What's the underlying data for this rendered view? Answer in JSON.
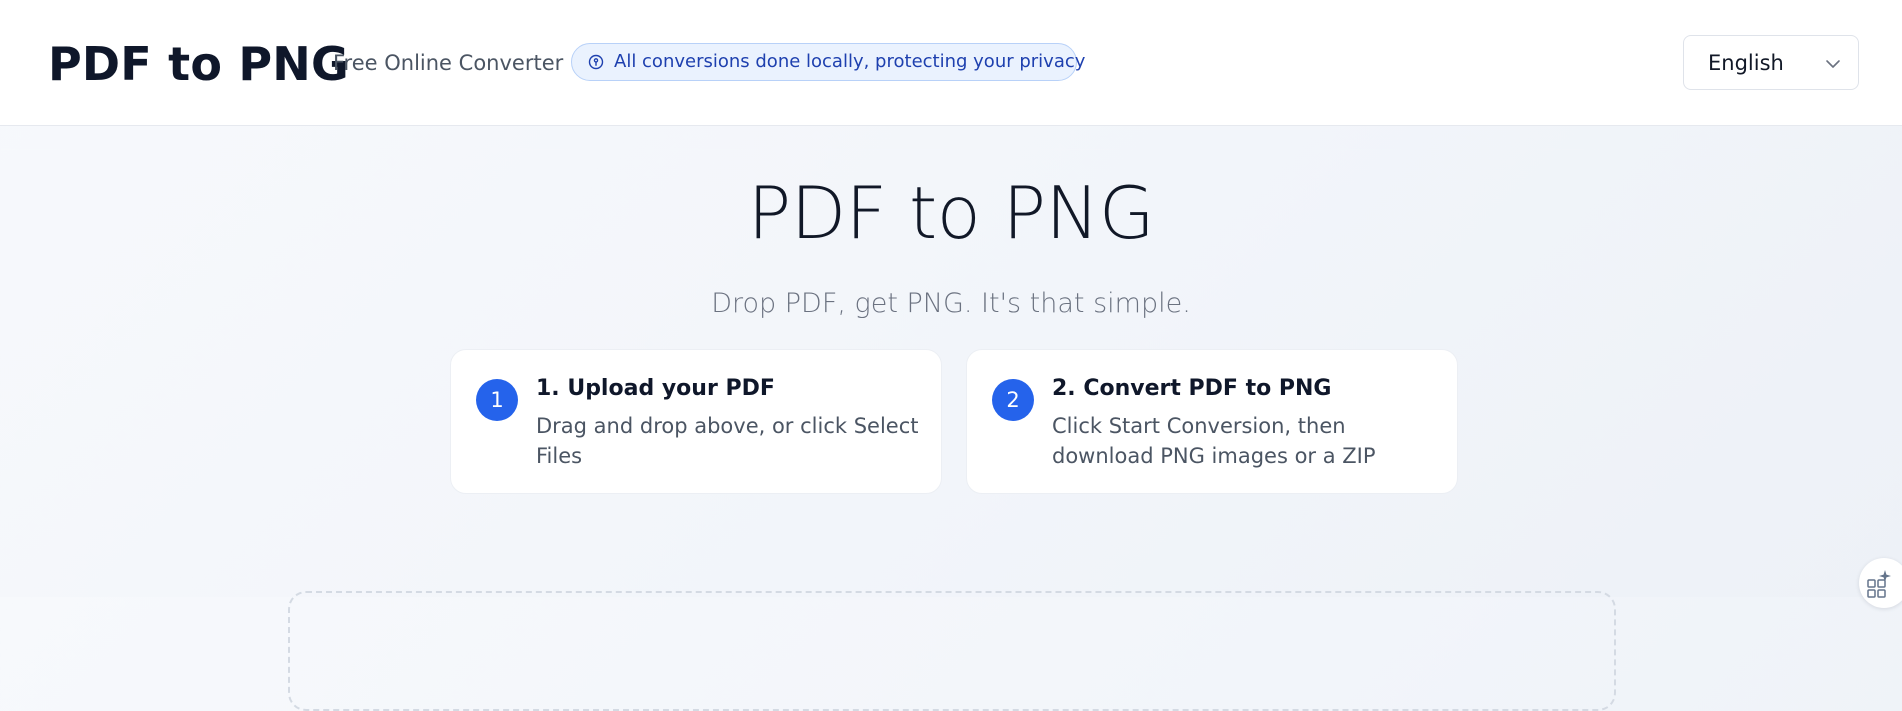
{
  "header": {
    "logo": "PDF to PNG",
    "tagline": "Free Online Converter",
    "privacy_notice": "All conversions done locally, protecting your privacy",
    "privacy_icon": "privacy-lock-icon",
    "language": {
      "selected": "English",
      "icon": "chevron-down-icon"
    }
  },
  "hero": {
    "title": "PDF to PNG",
    "subtitle": "Drop PDF, get PNG. It's that simple."
  },
  "steps": [
    {
      "number": "1",
      "title": "1. Upload your PDF",
      "description": "Drag and drop above, or click Select Files"
    },
    {
      "number": "2",
      "title": "2. Convert PDF to PNG",
      "description": "Click Start Conversion, then download PNG images or a ZIP"
    }
  ],
  "floating_widget": {
    "icon": "apps-sparkle-icon"
  },
  "colors": {
    "accent": "#2563eb",
    "privacy_bg": "#eaf2fe",
    "privacy_text": "#1e40af",
    "text_primary": "#0f172a",
    "text_secondary": "#4b5563"
  }
}
